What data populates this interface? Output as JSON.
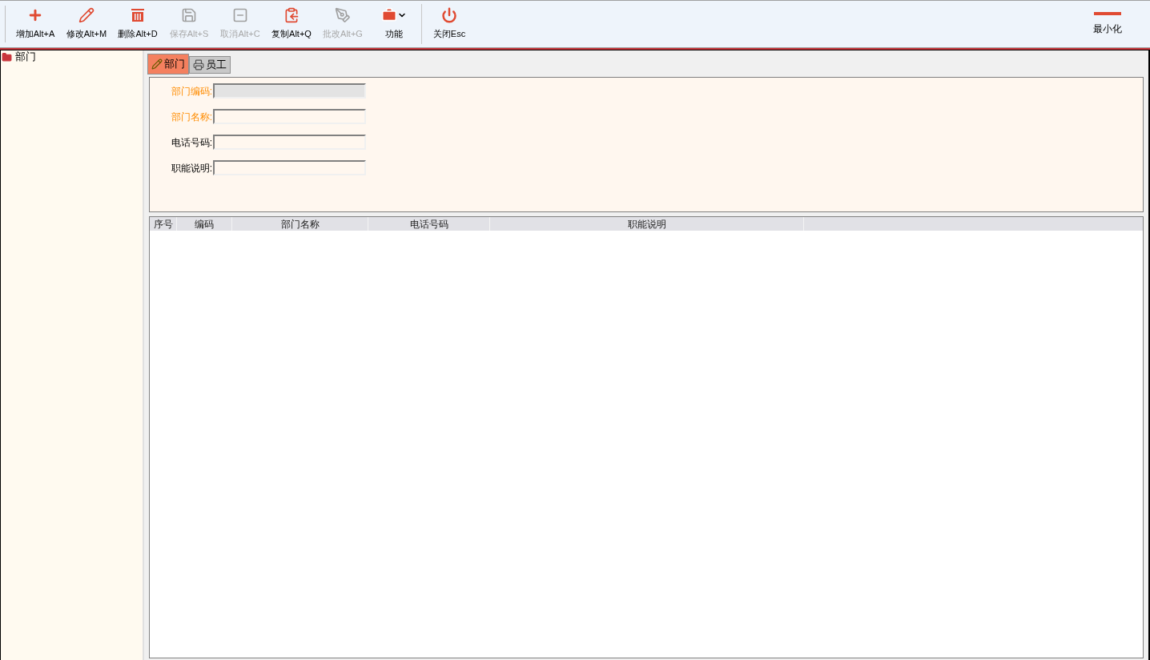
{
  "toolbar": {
    "buttons": [
      {
        "kind": "add",
        "label": "增加Alt+A",
        "disabled": false
      },
      {
        "kind": "edit",
        "label": "修改Alt+M",
        "disabled": false
      },
      {
        "kind": "delete",
        "label": "删除Alt+D",
        "disabled": false
      },
      {
        "kind": "save",
        "label": "保存Alt+S",
        "disabled": true
      },
      {
        "kind": "cancel",
        "label": "取消Alt+C",
        "disabled": true
      },
      {
        "kind": "copy",
        "label": "复制Alt+Q",
        "disabled": false
      },
      {
        "kind": "approve",
        "label": "批改Alt+G",
        "disabled": true
      },
      {
        "kind": "functions",
        "label": "功能",
        "disabled": false
      },
      {
        "kind": "close",
        "label": "关闭Esc",
        "disabled": false
      }
    ],
    "minimize": {
      "label": "最小化"
    }
  },
  "tree": {
    "items": [
      {
        "label": "部门"
      }
    ]
  },
  "tabs": [
    {
      "label": "部门",
      "selected": true,
      "kind": "dept"
    },
    {
      "label": "员工",
      "selected": false,
      "kind": "staff"
    }
  ],
  "form": {
    "fields": [
      {
        "label": "部门编码:",
        "required": true,
        "disabled": true
      },
      {
        "label": "部门名称:",
        "required": true,
        "disabled": false
      },
      {
        "label": "电话号码:",
        "required": false,
        "disabled": false
      },
      {
        "label": "职能说明:",
        "required": false,
        "disabled": false
      }
    ]
  },
  "table": {
    "columns": [
      "序号",
      "编码",
      "部门名称",
      "电话号码",
      "职能说明"
    ]
  }
}
